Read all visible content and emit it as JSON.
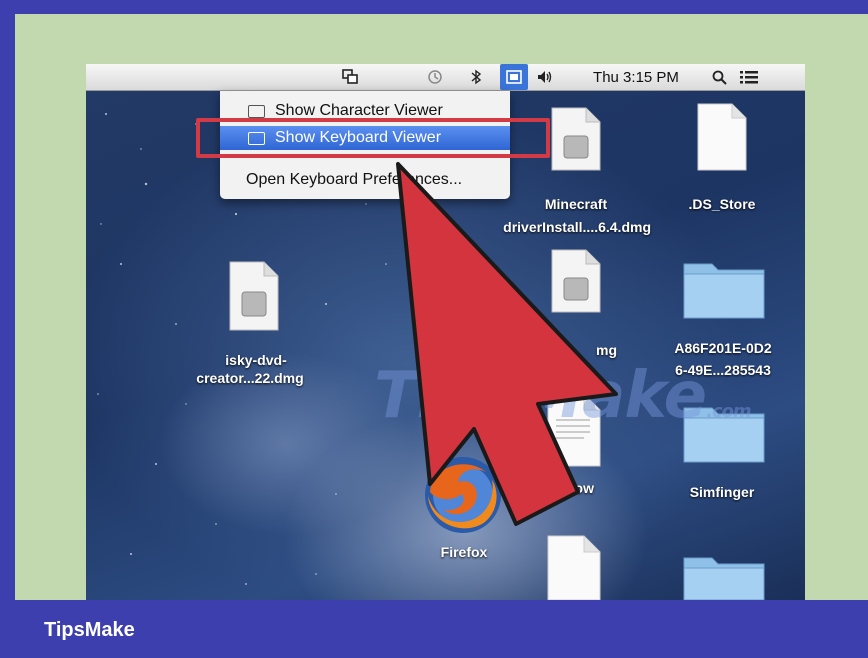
{
  "menubar": {
    "clock": "Thu 3:15 PM"
  },
  "input_menu": {
    "items": [
      {
        "label": "Show Character Viewer"
      },
      {
        "label": "Show Keyboard Viewer",
        "selected": true
      },
      {
        "label": "Open Keyboard Preferences..."
      }
    ]
  },
  "desktop": {
    "icons": [
      {
        "label_line1": "Minecraft",
        "label_line2": "driverInstall....6.4.dmg"
      },
      {
        "label_line1": ".DS_Store",
        "label_line2": ""
      },
      {
        "label_line1": "isky-dvd-",
        "label_line2": "creator...22.dmg"
      },
      {
        "label_line1": "A86F201E-0D2",
        "label_line2": "6-49E...285543"
      },
      {
        "label_line1": "Simfinger",
        "label_line2": ""
      },
      {
        "label_line1": "Firefox",
        "label_line2": ""
      },
      {
        "label_line1": "mg",
        "label_line2": ""
      },
      {
        "label_line1": "how",
        "label_line2": ""
      }
    ]
  },
  "watermark": {
    "text": "TipsMake",
    "suffix": ".com"
  },
  "footer": {
    "brand": "TipsMake"
  },
  "colors": {
    "frame": "#3c3fad",
    "panel": "#c2d9b0",
    "highlight": "#d23a45",
    "arrow": "#d4343d",
    "menu_selected": "#3b74d8"
  }
}
